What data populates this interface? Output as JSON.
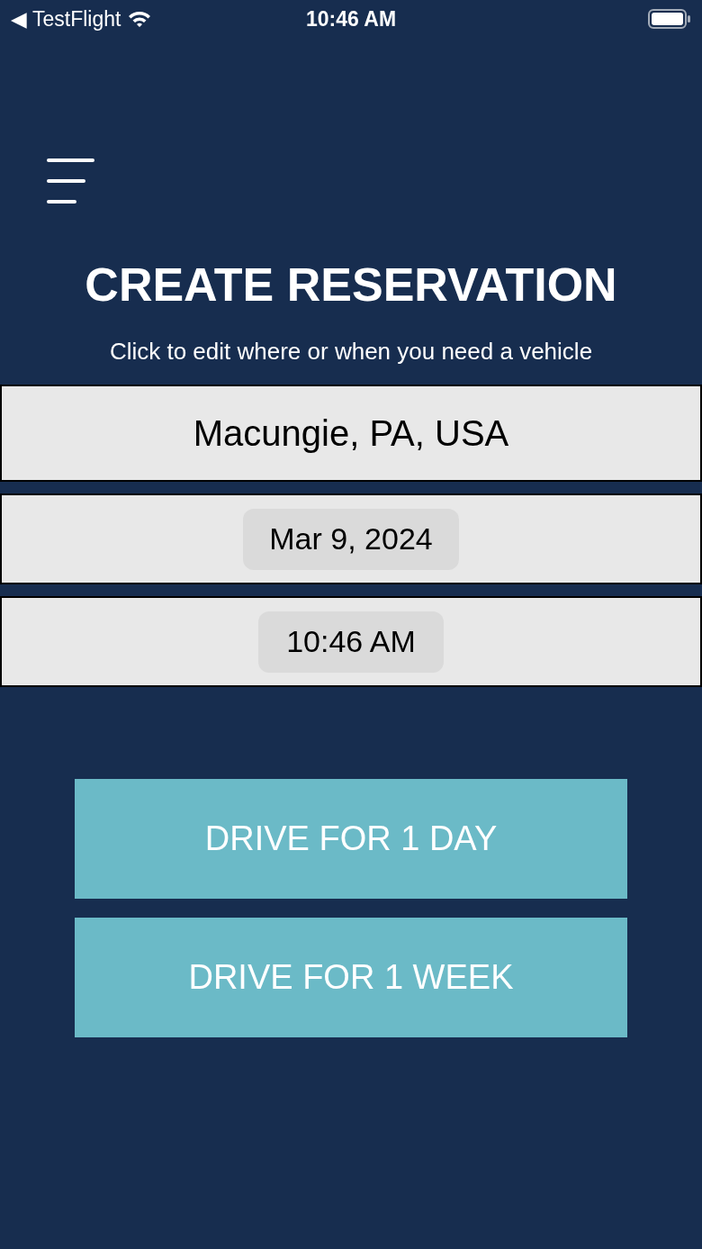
{
  "status_bar": {
    "back_label": "◀ TestFlight",
    "time": "10:46 AM"
  },
  "title": "CREATE RESERVATION",
  "subtitle": "Click to edit where or when you need a vehicle",
  "location": "Macungie, PA, USA",
  "date": "Mar 9, 2024",
  "time": "10:46 AM",
  "buttons": [
    "DRIVE FOR 1 DAY",
    "DRIVE FOR 1 WEEK"
  ]
}
